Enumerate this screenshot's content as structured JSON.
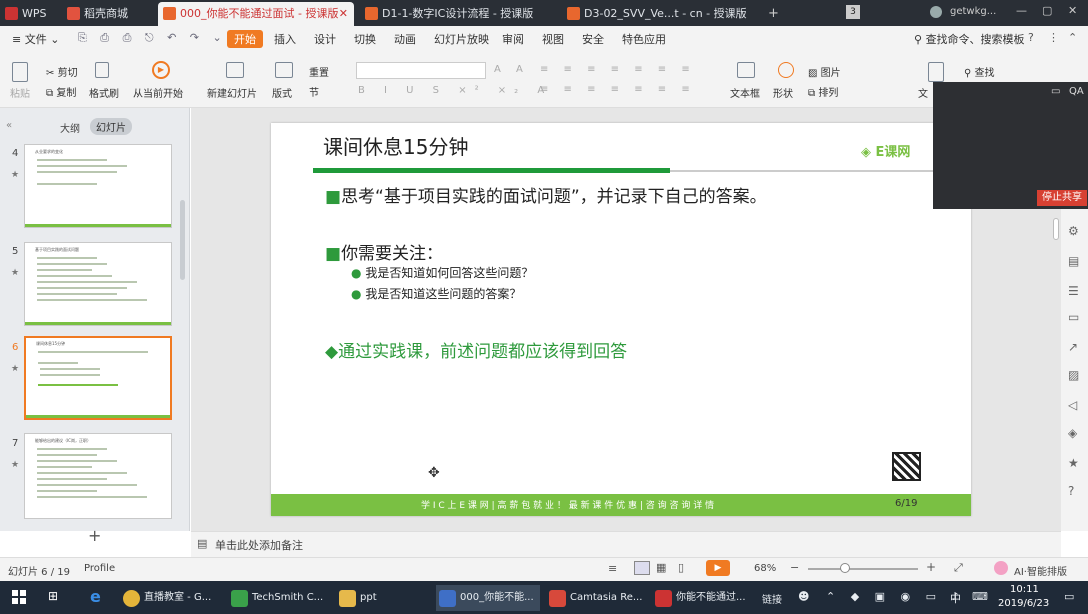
{
  "tabs": [
    {
      "label": "WPS"
    },
    {
      "label": "稻壳商城"
    },
    {
      "label": "000_你能不能通过面试 - 授课版"
    },
    {
      "label": "D1-1-数字IC设计流程 - 授课版"
    },
    {
      "label": "D3-02_SVV_Ve...t - cn - 授课版"
    }
  ],
  "tab_right": {
    "badge": "3",
    "user": "getwkg..."
  },
  "menu": {
    "file": "文件",
    "items": [
      "开始",
      "插入",
      "设计",
      "切换",
      "动画",
      "幻灯片放映",
      "审阅",
      "视图",
      "安全",
      "特色应用"
    ],
    "search": "查找命令、搜索模板"
  },
  "ribbon": {
    "paste": "粘贴",
    "cut": "剪切",
    "copy": "复制",
    "format_painter": "格式刷",
    "from_current": "从当前开始",
    "new_slide": "新建幻灯片",
    "layout": "版式",
    "reset": "重置",
    "section": "节",
    "textbox": "文本框",
    "shape": "形状",
    "picture": "图片",
    "arrange": "排列",
    "find": "查找",
    "text": "文"
  },
  "left_panel": {
    "tab_outline": "大纲",
    "tab_slides": "幻灯片",
    "thumbs": [
      {
        "num": "4",
        "title": "从业要求的变化"
      },
      {
        "num": "5",
        "title": "基于项目实践的面试问题"
      },
      {
        "num": "6",
        "title": "课间休息15分钟"
      },
      {
        "num": "7",
        "title": "能够给出的建议（IC岗，正职）"
      }
    ],
    "add": "+"
  },
  "slide": {
    "title": "课间休息15分钟",
    "logo": "E课网",
    "bullet1": "思考“基于项目实践的面试问题”，并记录下自己的答案。",
    "bullet2": "你需要关注：",
    "sub1": "我是否知道如何回答这些问题？",
    "sub2": "我是否知道这些问题的答案？",
    "highlight": "通过实践课，前述问题都应该得到回答",
    "footer": "学 I C 上 E 课 网  |  高 薪 包 就 业 ！  最 新 课 件 优 惠  |  咨 询 咨 询 详 情",
    "page": "6/19"
  },
  "notes": {
    "placeholder": "单击此处添加备注"
  },
  "status": {
    "slide_count": "幻灯片 6 / 19",
    "profile": "Profile",
    "zoom": "68%",
    "ai": "AI·智能排版"
  },
  "cam": {
    "stop_share": "停止共享"
  },
  "taskbar": {
    "items": [
      {
        "label": "直播教室 - G..."
      },
      {
        "label": "TechSmith C..."
      },
      {
        "label": "ppt"
      },
      {
        "label": "000_你能不能..."
      },
      {
        "label": "Camtasia Re..."
      },
      {
        "label": "你能不能通过..."
      }
    ],
    "link": "链接",
    "ime": "中",
    "time": "10:11",
    "date": "2019/6/23"
  },
  "colors": {
    "accent": "#f07a22",
    "green": "#7ac043",
    "title_green": "#2e9a3c",
    "wps_red": "#c33"
  }
}
